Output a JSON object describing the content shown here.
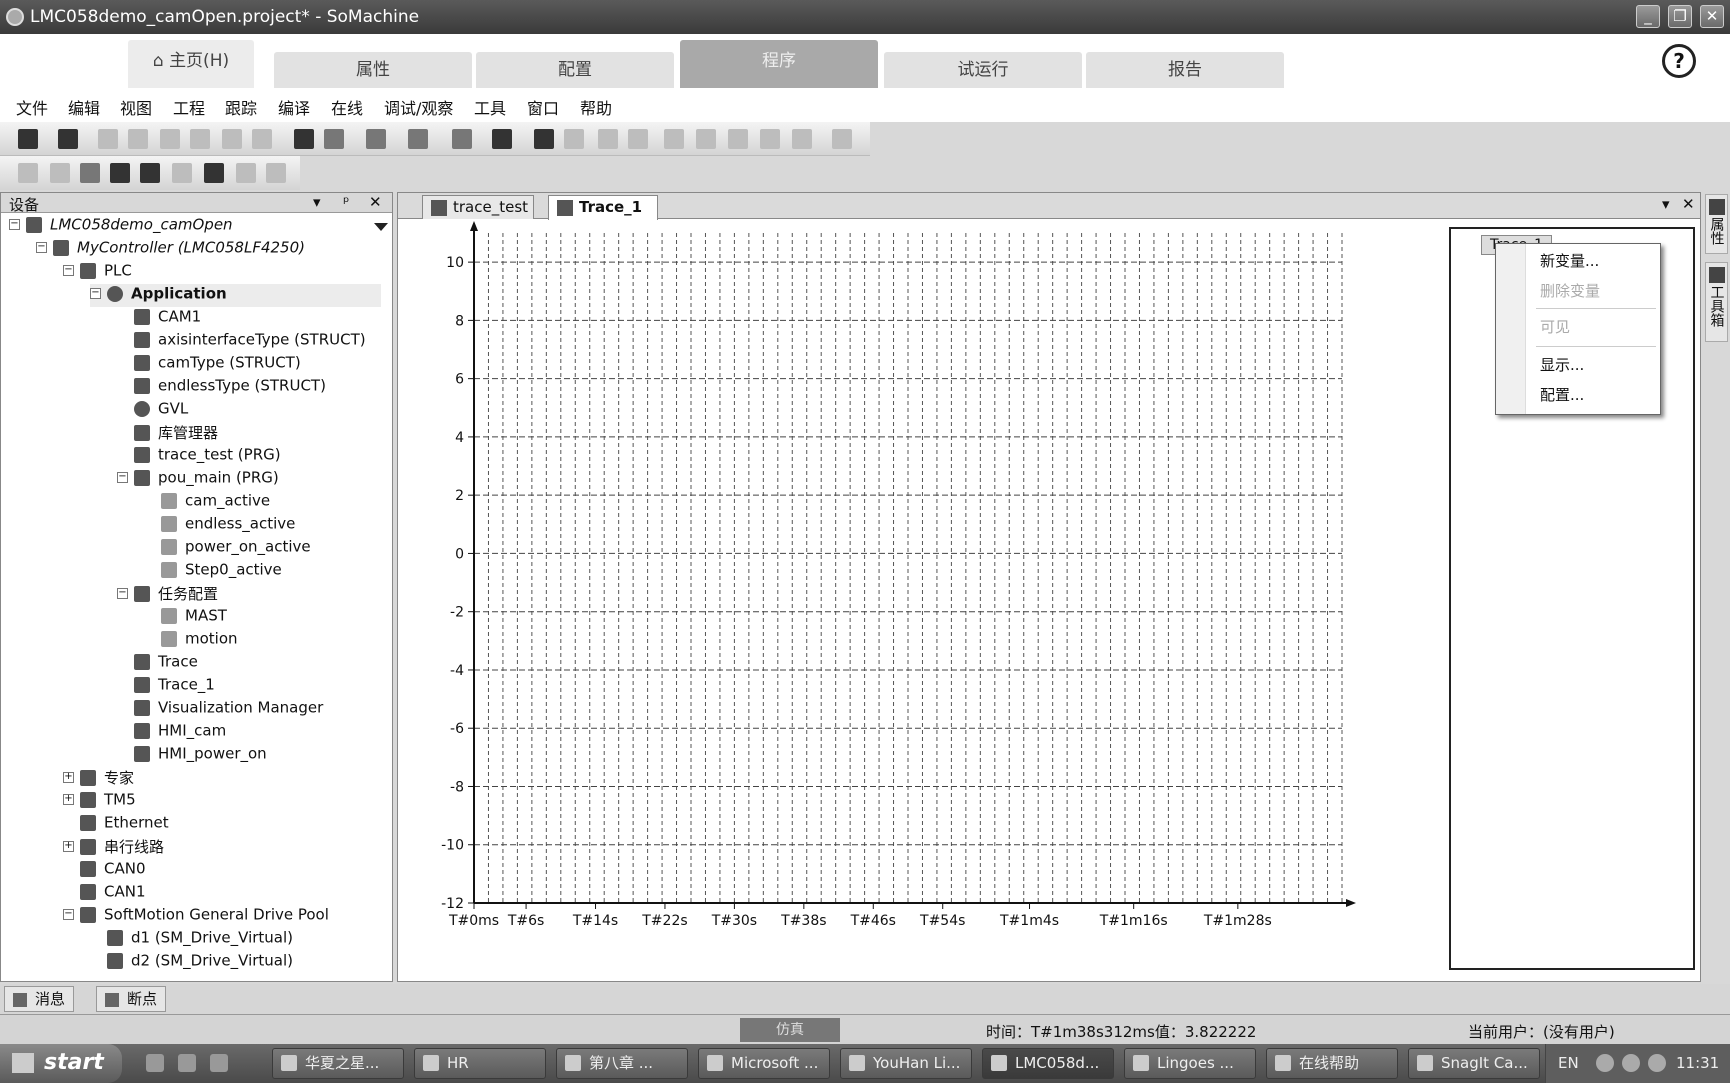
{
  "window": {
    "title": "LMC058demo_camOpen.project* - SoMachine",
    "buttons": [
      "_",
      "❐",
      "✕"
    ]
  },
  "ribbon": {
    "home": "主页(H)",
    "tabs": [
      "属性",
      "配置",
      "程序",
      "试运行",
      "报告"
    ],
    "active_tab": "程序"
  },
  "menu": [
    "文件",
    "编辑",
    "视图",
    "工程",
    "跟踪",
    "编译",
    "在线",
    "调试/观察",
    "工具",
    "窗口",
    "帮助"
  ],
  "devices_panel": {
    "title": "设备",
    "controls": [
      "▾",
      "ᵖ",
      "✕"
    ],
    "tree": [
      {
        "label": "LMC058demo_camOpen",
        "level": 0,
        "exp": "−",
        "italic": true
      },
      {
        "label": "MyController (LMC058LF4250)",
        "level": 1,
        "exp": "−",
        "italic": true
      },
      {
        "label": "PLC",
        "level": 2,
        "exp": "−"
      },
      {
        "label": "Application",
        "level": 3,
        "exp": "−",
        "bold": true,
        "selected": true
      },
      {
        "label": "CAM1",
        "level": 4
      },
      {
        "label": "axisinterfaceType (STRUCT)",
        "level": 4
      },
      {
        "label": "camType (STRUCT)",
        "level": 4
      },
      {
        "label": "endlessType (STRUCT)",
        "level": 4
      },
      {
        "label": "GVL",
        "level": 4
      },
      {
        "label": "库管理器",
        "level": 4
      },
      {
        "label": "trace_test (PRG)",
        "level": 4
      },
      {
        "label": "pou_main (PRG)",
        "level": 4,
        "exp": "−"
      },
      {
        "label": "cam_active",
        "level": 5
      },
      {
        "label": "endless_active",
        "level": 5
      },
      {
        "label": "power_on_active",
        "level": 5
      },
      {
        "label": "Step0_active",
        "level": 5
      },
      {
        "label": "任务配置",
        "level": 4,
        "exp": "−"
      },
      {
        "label": "MAST",
        "level": 5
      },
      {
        "label": "motion",
        "level": 5
      },
      {
        "label": "Trace",
        "level": 4
      },
      {
        "label": "Trace_1",
        "level": 4
      },
      {
        "label": "Visualization Manager",
        "level": 4
      },
      {
        "label": "HMI_cam",
        "level": 4
      },
      {
        "label": "HMI_power_on",
        "level": 4
      },
      {
        "label": "专家",
        "level": 2,
        "exp": "+"
      },
      {
        "label": "TM5",
        "level": 2,
        "exp": "+"
      },
      {
        "label": "Ethernet",
        "level": 2
      },
      {
        "label": "串行线路",
        "level": 2,
        "exp": "+"
      },
      {
        "label": "CAN0",
        "level": 2
      },
      {
        "label": "CAN1",
        "level": 2
      },
      {
        "label": "SoftMotion General Drive Pool",
        "level": 2,
        "exp": "−"
      },
      {
        "label": "d1 (SM_Drive_Virtual)",
        "level": 3
      },
      {
        "label": "d2 (SM_Drive_Virtual)",
        "level": 3
      }
    ]
  },
  "bottom_tabs": [
    "消息",
    "断点"
  ],
  "editor": {
    "tabs": [
      "trace_test",
      "Trace_1"
    ],
    "active_tab": "Trace_1",
    "controls": [
      "▾",
      "✕"
    ]
  },
  "chart_data": {
    "type": "line",
    "title": "",
    "xlabel": "",
    "ylabel": "",
    "ylim": [
      -12,
      11
    ],
    "y_ticks": [
      10,
      8,
      6,
      4,
      2,
      0,
      -2,
      -4,
      -6,
      -8,
      -10,
      -12
    ],
    "x_ticks": [
      "T#0ms",
      "T#6s",
      "T#14s",
      "T#22s",
      "T#30s",
      "T#38s",
      "T#46s",
      "T#54s",
      "T#1m4s",
      "T#1m16s",
      "T#1m28s"
    ],
    "x_tick_seconds": [
      0,
      6,
      14,
      22,
      30,
      38,
      46,
      54,
      64,
      76,
      88
    ],
    "x_range_seconds": [
      0,
      100
    ],
    "series": [],
    "grid": true
  },
  "trace_legend": {
    "entry": "Trace_1",
    "context_menu": [
      {
        "label": "新变量...",
        "enabled": true
      },
      {
        "label": "删除变量",
        "enabled": false
      },
      {
        "label": "可见",
        "enabled": false
      },
      {
        "label": "显示...",
        "enabled": true
      },
      {
        "label": "配置...",
        "enabled": true
      }
    ]
  },
  "right_strip": [
    "属性",
    "工具箱"
  ],
  "status": {
    "sim": "仿真",
    "time_value": "时间：T#1m38s312ms值：3.822222",
    "user": "当前用户：(没有用户)"
  },
  "taskbar": {
    "start": "start",
    "tasks": [
      "华夏之星...",
      "HR",
      "第八章 ...",
      "Microsoft ...",
      "YouHan Li...",
      "LMC058d...",
      "Lingoes ...",
      "在线帮助",
      "SnagIt Ca..."
    ],
    "active_task": "LMC058d...",
    "lang": "EN",
    "clock": "11:31"
  }
}
